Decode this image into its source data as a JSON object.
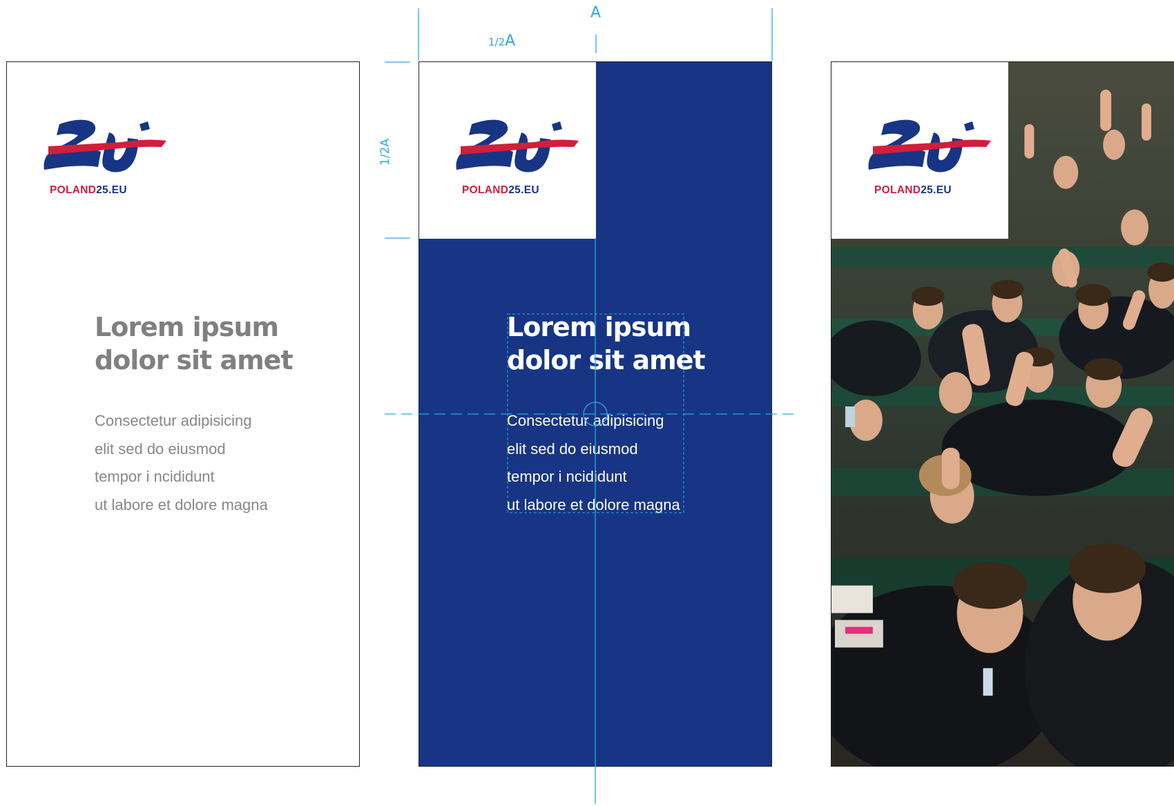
{
  "brand": {
    "logo_text_red": "POLAND",
    "logo_text_blue": "25.EU",
    "colors": {
      "navy": "#173584",
      "red": "#d01f3c",
      "guide": "#29abe2",
      "gray": "#808080"
    }
  },
  "panels": [
    {
      "variant": "white",
      "title_lines": [
        "Lorem ipsum",
        "dolor sit amet"
      ],
      "body_lines": [
        "Consectetur adipisicing",
        "elit sed do eiusmod",
        "tempor i ncididunt",
        "ut labore et dolore magna"
      ]
    },
    {
      "variant": "navy",
      "title_lines": [
        "Lorem ipsum",
        "dolor sit amet"
      ],
      "body_lines": [
        "Consectetur adipisicing",
        "elit sed do eiusmod",
        "tempor i ncididunt",
        "ut labore et dolore magna"
      ]
    },
    {
      "variant": "photo",
      "photo_alt": "young people raising hands in a parliament hall"
    }
  ],
  "dimensions": {
    "width_label": "A",
    "half_width_prefix": "1/2",
    "half_width_suffix": "A",
    "half_height_label": "1/2A"
  }
}
